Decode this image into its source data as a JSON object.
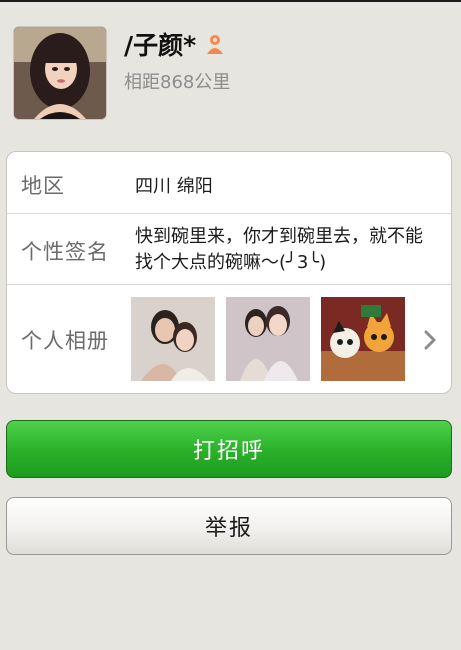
{
  "profile": {
    "name": "/子颜*",
    "distance": "相距868公里",
    "gender_icon": "female-user-icon",
    "avatar": "profile-photo"
  },
  "details": {
    "region_label": "地区",
    "region_value": "四川 绵阳",
    "signature_label": "个性签名",
    "signature_value": "快到碗里来，你才到碗里去，就不能找个大点的碗嘛～(╯3╰)",
    "album_label": "个人相册",
    "album_thumbs": [
      "couple-photo",
      "couple-photo",
      "cartoon-foxes-photo"
    ],
    "chevron_icon": "chevron-right-icon"
  },
  "actions": {
    "greet_label": "打招呼",
    "report_label": "举报"
  },
  "colors": {
    "background": "#e7e5e0",
    "greet_button": "#2cb22b",
    "gender_icon": "#f08a4b"
  }
}
